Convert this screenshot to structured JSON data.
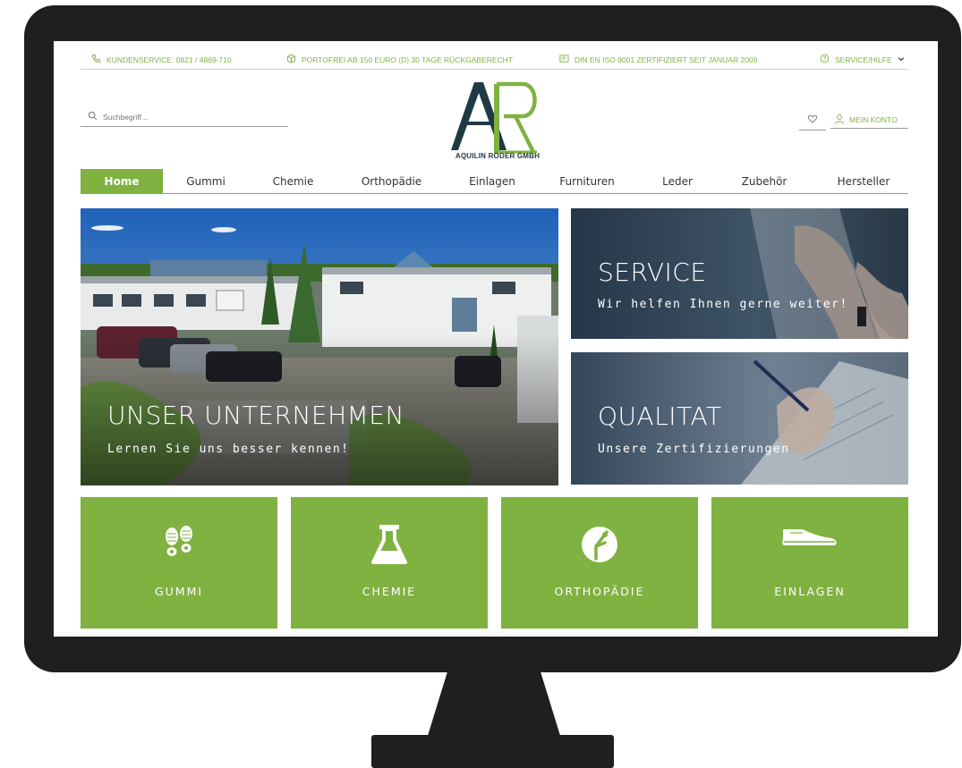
{
  "topbar": {
    "phone": "KUNDENSERVICE: 0821 / 4869-710",
    "shipping": "PORTOFREI AB 150 EURO (D) 30 TAGE RÜCKGABERECHT",
    "cert": "DIN EN ISO 9001 ZERTIFIZIERT SEIT JANUAR 2009",
    "service": "SERVICE/HILFE"
  },
  "header": {
    "search_placeholder": "Suchbegriff...",
    "logo_text": "AQUILIN RÖDER GMBH",
    "account_label": "MEIN KONTO"
  },
  "nav": [
    {
      "label": "Home",
      "active": true
    },
    {
      "label": "Gummi"
    },
    {
      "label": "Chemie"
    },
    {
      "label": "Orthopädie"
    },
    {
      "label": "Einlagen"
    },
    {
      "label": "Furnituren"
    },
    {
      "label": "Leder"
    },
    {
      "label": "Zubehör"
    },
    {
      "label": "Hersteller"
    }
  ],
  "hero": {
    "main": {
      "title": "UNSER UNTERNEHMEN",
      "subtitle": "Lernen Sie uns besser kennen!"
    },
    "service": {
      "title": "SERVICE",
      "subtitle": "Wir helfen Ihnen gerne weiter!"
    },
    "quality": {
      "title": "QUALITAT",
      "subtitle": "Unsere Zertifizierungen"
    }
  },
  "categories": [
    {
      "label": "GUMMI",
      "icon": "shoe-soles-icon"
    },
    {
      "label": "CHEMIE",
      "icon": "flask-icon"
    },
    {
      "label": "ORTHOPÄDIE",
      "icon": "orthopedic-icon"
    },
    {
      "label": "EINLAGEN",
      "icon": "shoe-insole-icon"
    }
  ],
  "colors": {
    "accent": "#7fb241",
    "logo_dark": "#1f3a44",
    "monitor": "#1f1f1f"
  }
}
